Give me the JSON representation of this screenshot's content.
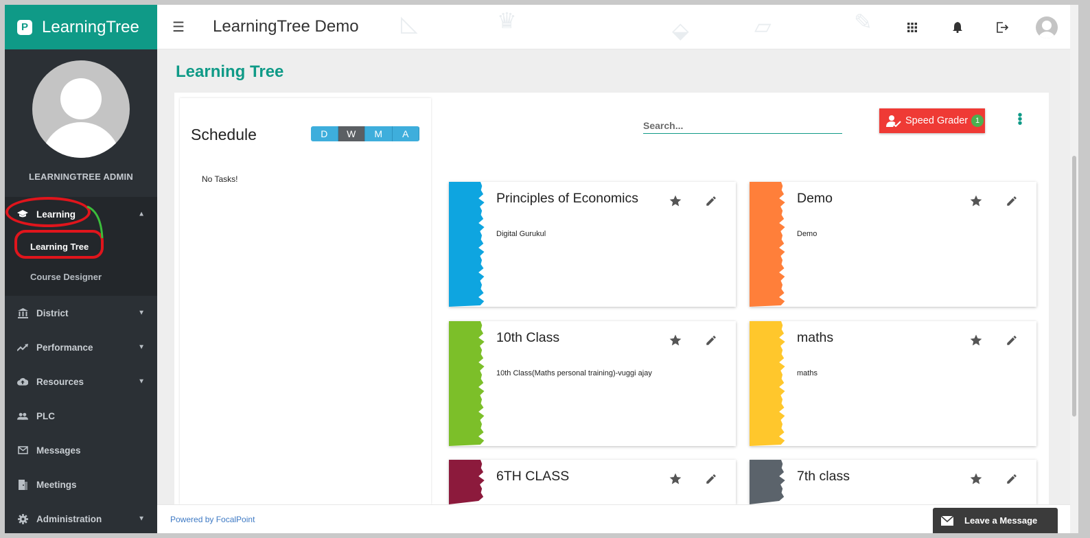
{
  "brand": {
    "name": "LearningTree",
    "logo_letter": "P"
  },
  "header": {
    "title": "LearningTree Demo",
    "icons": [
      "menu-icon",
      "apps-icon",
      "bell-icon",
      "logout-icon",
      "avatar"
    ]
  },
  "sidebar": {
    "user_name": "LEARNINGTREE ADMIN",
    "items": [
      {
        "label": "Learning",
        "icon": "graduation-cap-icon",
        "expanded": true
      },
      {
        "label": "District",
        "icon": "institution-icon"
      },
      {
        "label": "Performance",
        "icon": "trending-up-icon"
      },
      {
        "label": "Resources",
        "icon": "cloud-upload-icon"
      },
      {
        "label": "PLC",
        "icon": "people-icon"
      },
      {
        "label": "Messages",
        "icon": "envelope-icon"
      },
      {
        "label": "Meetings",
        "icon": "door-icon"
      },
      {
        "label": "Administration",
        "icon": "gear-icon"
      }
    ],
    "learning_sub": [
      {
        "label": "Learning Tree",
        "active": true
      },
      {
        "label": "Course Designer"
      }
    ]
  },
  "page": {
    "title": "Learning Tree"
  },
  "schedule": {
    "title": "Schedule",
    "views": [
      "D",
      "W",
      "M",
      "A"
    ],
    "active_view": "W",
    "empty_text": "No Tasks!"
  },
  "toolbar": {
    "search_placeholder": "Search...",
    "speed_grader_label": "Speed Grader",
    "speed_grader_count": "1"
  },
  "courses": [
    {
      "name": "Principles of Economics",
      "desc": "Digital Gurukul",
      "color": "#0ea5e0"
    },
    {
      "name": "Demo",
      "desc": "Demo",
      "color": "#ff7f3a"
    },
    {
      "name": "10th Class",
      "desc": "10th Class(Maths personal training)-vuggi ajay",
      "color": "#7cbf29"
    },
    {
      "name": "maths",
      "desc": "maths",
      "color": "#ffc72c"
    },
    {
      "name": "6TH CLASS",
      "desc": "",
      "color": "#8c1a3c"
    },
    {
      "name": "7th class",
      "desc": "",
      "color": "#5b636b"
    }
  ],
  "footer": {
    "powered_by": "Powered by FocalPoint",
    "leave_message": "Leave a Message"
  },
  "colors": {
    "brand": "#0f9a87",
    "sidebar": "#2b3035",
    "speed_grader": "#ef3a35",
    "annotation": "#e0151c"
  }
}
